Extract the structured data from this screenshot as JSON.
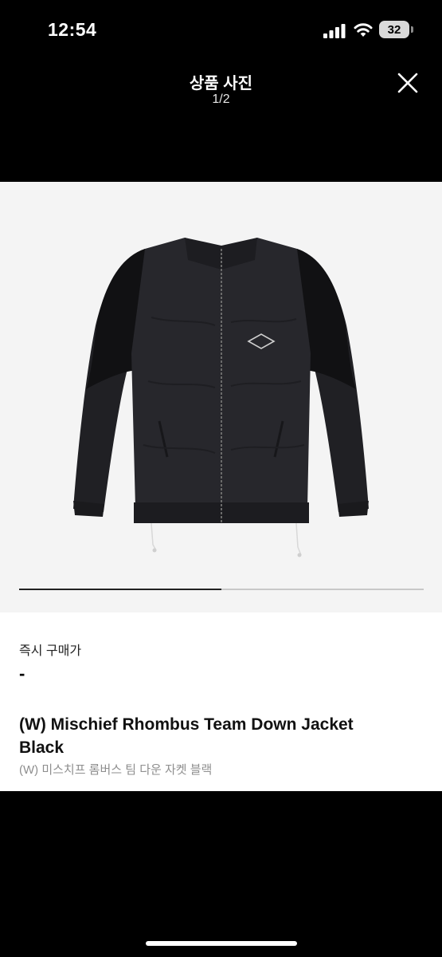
{
  "status_bar": {
    "time": "12:54",
    "battery": "32"
  },
  "header": {
    "title": "상품 사진",
    "counter": "1/2"
  },
  "gallery": {
    "current": 1,
    "total": 2,
    "progress": 0.5
  },
  "product": {
    "price_label": "즉시 구매가",
    "price_value": "-",
    "name_en": "(W) Mischief Rhombus Team Down Jacket Black",
    "name_ko": "(W) 미스치프 롬버스 팀 다운 자켓 블랙"
  },
  "colors": {
    "background": "#000000",
    "image_bg": "#f4f4f4",
    "card": "#ffffff",
    "subtext": "#8e8e8e"
  }
}
